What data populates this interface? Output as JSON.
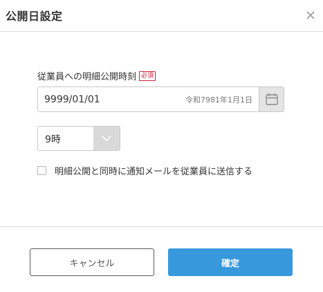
{
  "dialog": {
    "title": "公開日設定",
    "close_icon": "close-icon"
  },
  "form": {
    "date_label": "従業員への明細公開時刻",
    "required_badge": "必須",
    "date_value": "9999/01/01",
    "era_text": "令和7981年1月1日",
    "calendar_icon": "calendar-icon",
    "hour_value": "9時",
    "hour_dropdown_icon": "chevron-down-icon",
    "notify_checkbox_checked": false,
    "notify_label": "明細公開と同時に通知メールを従業員に送信する"
  },
  "footer": {
    "cancel_label": "キャンセル",
    "confirm_label": "確定"
  },
  "colors": {
    "accent": "#3898dc",
    "required": "#d2203b",
    "border": "#c8c8c8"
  }
}
